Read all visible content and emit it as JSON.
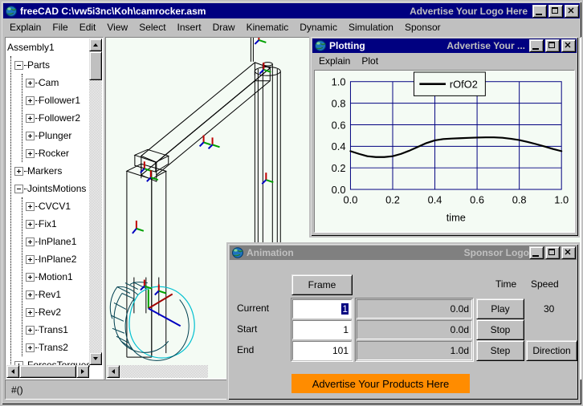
{
  "main_window": {
    "icon": "app-globe-icon",
    "title": "freeCAD C:\\vw5i3nc\\Koh\\camrocker.asm",
    "ad_text": "Advertise Your Logo Here",
    "buttons": {
      "minimize": "_",
      "maximize": "□",
      "close": "✕"
    }
  },
  "menubar": {
    "items": [
      "Explain",
      "File",
      "Edit",
      "View",
      "Select",
      "Insert",
      "Draw",
      "Kinematic",
      "Dynamic",
      "Simulation",
      "Sponsor"
    ]
  },
  "tree": {
    "root": "Assembly1",
    "nodes": [
      {
        "label": "Assembly1",
        "indent": 0,
        "toggle": "none"
      },
      {
        "label": "Parts",
        "indent": 1,
        "toggle": "minus"
      },
      {
        "label": "Cam",
        "indent": 2,
        "toggle": "plus"
      },
      {
        "label": "Follower1",
        "indent": 2,
        "toggle": "plus"
      },
      {
        "label": "Follower2",
        "indent": 2,
        "toggle": "plus"
      },
      {
        "label": "Plunger",
        "indent": 2,
        "toggle": "plus"
      },
      {
        "label": "Rocker",
        "indent": 2,
        "toggle": "plus"
      },
      {
        "label": "Markers",
        "indent": 1,
        "toggle": "plus"
      },
      {
        "label": "JointsMotions",
        "indent": 1,
        "toggle": "minus"
      },
      {
        "label": "CVCV1",
        "indent": 2,
        "toggle": "plus"
      },
      {
        "label": "Fix1",
        "indent": 2,
        "toggle": "plus"
      },
      {
        "label": "InPlane1",
        "indent": 2,
        "toggle": "plus"
      },
      {
        "label": "InPlane2",
        "indent": 2,
        "toggle": "plus"
      },
      {
        "label": "Motion1",
        "indent": 2,
        "toggle": "plus"
      },
      {
        "label": "Rev1",
        "indent": 2,
        "toggle": "plus"
      },
      {
        "label": "Rev2",
        "indent": 2,
        "toggle": "plus"
      },
      {
        "label": "Trans1",
        "indent": 2,
        "toggle": "plus"
      },
      {
        "label": "Trans2",
        "indent": 2,
        "toggle": "plus"
      },
      {
        "label": "ForcesTorques",
        "indent": 1,
        "toggle": "plus"
      }
    ]
  },
  "statusbar": {
    "text": "#()"
  },
  "plot_window": {
    "icon": "app-globe-icon",
    "title": "Plotting",
    "ad_text": "Advertise Your ...",
    "menu": [
      "Explain",
      "Plot"
    ],
    "buttons": {
      "minimize": "_",
      "maximize": "□",
      "close": "✕"
    }
  },
  "chart_data": {
    "type": "line",
    "title": "",
    "xlabel": "time",
    "ylabel": "",
    "xlim": [
      0.0,
      1.0
    ],
    "ylim": [
      0.0,
      1.0
    ],
    "xticks": [
      "0.0",
      "0.2",
      "0.4",
      "0.6",
      "0.8",
      "1.0"
    ],
    "yticks": [
      "0.0",
      "0.2",
      "0.4",
      "0.6",
      "0.8",
      "1.0"
    ],
    "grid": true,
    "grid_color": "#000080",
    "legend": {
      "position": "top-center",
      "entries": [
        "rOfO2"
      ]
    },
    "series": [
      {
        "name": "rOfO2",
        "color": "#000000",
        "x": [
          0.0,
          0.04,
          0.08,
          0.12,
          0.16,
          0.2,
          0.24,
          0.28,
          0.32,
          0.36,
          0.4,
          0.44,
          0.48,
          0.52,
          0.56,
          0.6,
          0.64,
          0.68,
          0.72,
          0.76,
          0.8,
          0.84,
          0.88,
          0.92,
          0.96,
          1.0
        ],
        "y": [
          0.355,
          0.33,
          0.308,
          0.3,
          0.3,
          0.308,
          0.33,
          0.36,
          0.395,
          0.43,
          0.455,
          0.467,
          0.472,
          0.475,
          0.478,
          0.481,
          0.483,
          0.483,
          0.479,
          0.47,
          0.458,
          0.44,
          0.42,
          0.398,
          0.375,
          0.355
        ]
      }
    ]
  },
  "animation_window": {
    "icon": "app-globe-icon",
    "title": "Animation",
    "ad_text": "Sponsor Logo",
    "buttons": {
      "minimize": "_",
      "maximize": "□",
      "close": "✕"
    },
    "frame_button": "Frame",
    "headers": {
      "time": "Time",
      "speed": "Speed"
    },
    "rows": [
      {
        "label": "Current",
        "frame": "1",
        "frame_selected": true,
        "time": "0.0d"
      },
      {
        "label": "Start",
        "frame": "1",
        "frame_selected": false,
        "time": "0.0d"
      },
      {
        "label": "End",
        "frame": "101",
        "frame_selected": false,
        "time": "1.0d"
      }
    ],
    "controls": [
      "Play",
      "Stop",
      "Step"
    ],
    "direction_button": "Direction",
    "speed_value": "30",
    "ad_banner": "Advertise Your Products Here",
    "ad_banner_color": "#ff8c00"
  }
}
